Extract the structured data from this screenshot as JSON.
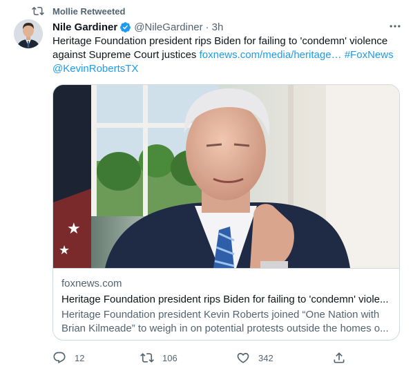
{
  "retweet_banner": {
    "icon": "retweet-icon",
    "text": "Mollie Retweeted"
  },
  "author": {
    "avatar": "avatar-photo",
    "display_name": "Nile Gardiner",
    "verified": true,
    "handle": "@NileGardiner",
    "separator": "·",
    "time": "3h"
  },
  "more_icon": "more-horizontal-icon",
  "tweet": {
    "text": "Heritage Foundation president rips Biden for failing to 'condemn' violence against Supreme Court justices",
    "link": "foxnews.com/media/heritage…",
    "hashtag": "#FoxNews",
    "mention": "@KevinRobertsTX"
  },
  "card": {
    "image": "news-photo-portrait",
    "domain": "foxnews.com",
    "title": "Heritage Foundation president rips Biden for failing to 'condemn' viole...",
    "description": "Heritage Foundation president Kevin Roberts joined “One Nation with Brian Kilmeade” to weigh in on potential protests outside the homes o..."
  },
  "actions": {
    "reply": {
      "icon": "reply-icon",
      "count": "12"
    },
    "retweet": {
      "icon": "retweet-icon",
      "count": "106"
    },
    "like": {
      "icon": "heart-icon",
      "count": "342"
    },
    "share": {
      "icon": "share-icon"
    }
  },
  "colors": {
    "link": "#1d9bf0",
    "secondary_text": "#536471",
    "primary_text": "#0f1419",
    "border": "#cfd9de"
  }
}
